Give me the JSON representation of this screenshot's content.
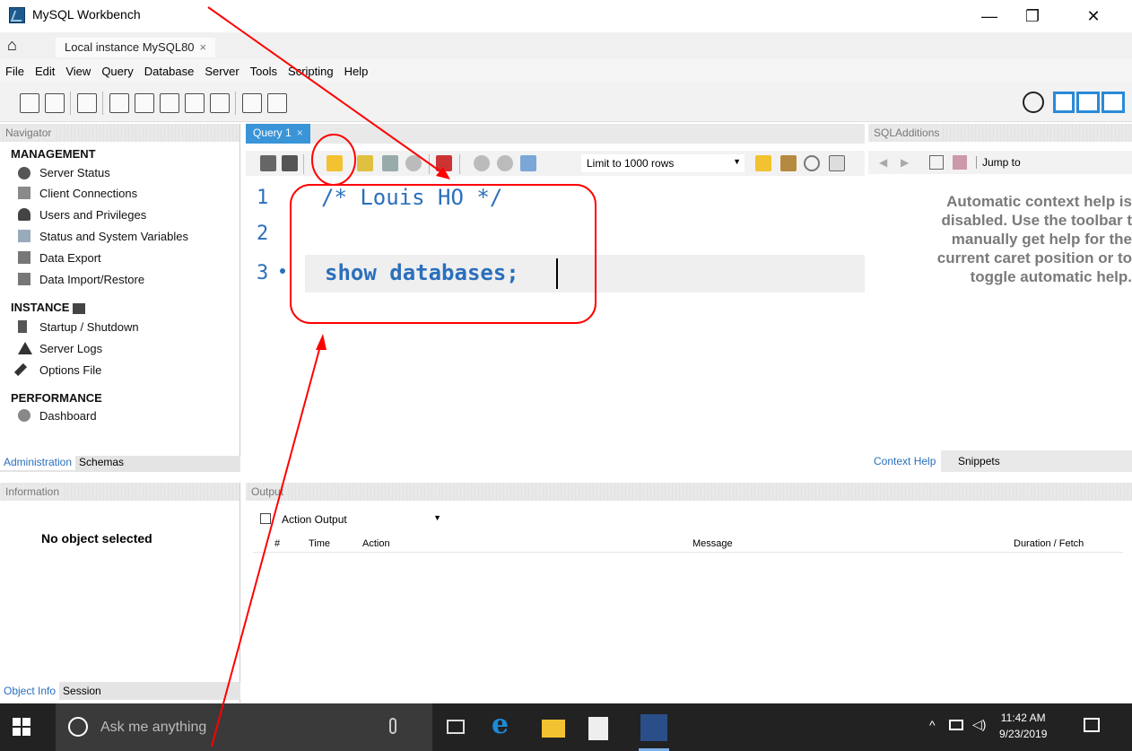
{
  "window": {
    "title": "MySQL Workbench",
    "minimize_label": "—",
    "restore_label": "❐",
    "close_label": "✕"
  },
  "tabs": {
    "home_icon": "home-icon",
    "connection_tab": "Local instance MySQL80",
    "connection_tab_close": "×"
  },
  "menu": {
    "items": [
      "File",
      "Edit",
      "View",
      "Query",
      "Database",
      "Server",
      "Tools",
      "Scripting",
      "Help"
    ]
  },
  "navigator": {
    "header": "Navigator",
    "management_title": "MANAGEMENT",
    "management_items": [
      "Server Status",
      "Client Connections",
      "Users and Privileges",
      "Status and System Variables",
      "Data Export",
      "Data Import/Restore"
    ],
    "instance_title": "INSTANCE",
    "instance_items": [
      "Startup / Shutdown",
      "Server Logs",
      "Options File"
    ],
    "performance_title": "PERFORMANCE",
    "performance_items": [
      "Dashboard"
    ],
    "tabs": [
      "Administration",
      "Schemas"
    ]
  },
  "information": {
    "header": "Information",
    "empty_text": "No object selected",
    "tabs": [
      "Object Info",
      "Session"
    ]
  },
  "query": {
    "tab_label": "Query 1",
    "tab_close": "×",
    "limit_select": "Limit to 1000 rows",
    "line_numbers": [
      "1",
      "2",
      "3"
    ],
    "line1": "/* Louis HO */",
    "line3": "show databases;"
  },
  "sql_additions": {
    "header": "SQLAdditions",
    "jump_to": "Jump to",
    "context_help": "Automatic context help is\ndisabled. Use the toolbar t\nmanually get help for the\ncurrent caret position or to\ntoggle automatic help.",
    "tabs": [
      "Context Help",
      "Snippets"
    ]
  },
  "output": {
    "header": "Output",
    "selector": "Action Output",
    "columns": [
      "#",
      "Time",
      "Action",
      "Message",
      "Duration / Fetch"
    ]
  },
  "taskbar": {
    "search_placeholder": "Ask me anything",
    "time": "11:42 AM",
    "date": "9/23/2019"
  },
  "colors": {
    "query_tab": "#3a95d8",
    "annotation": "#ff0000",
    "taskbar": "#222222"
  }
}
